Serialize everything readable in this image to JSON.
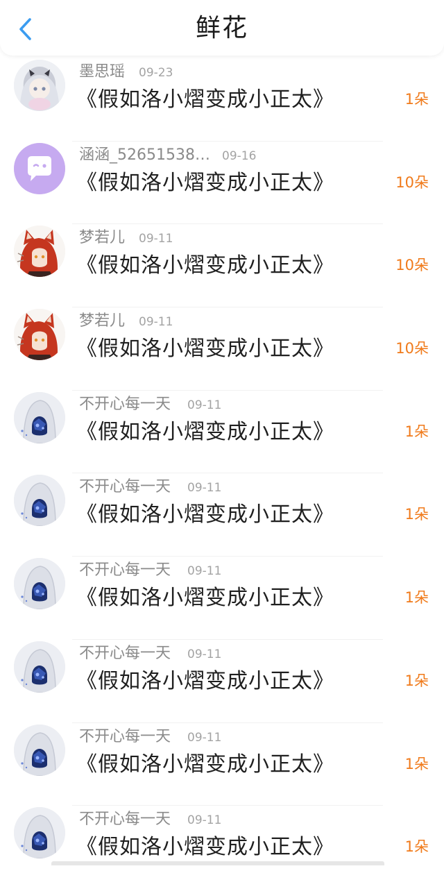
{
  "header": {
    "title": "鲜花",
    "back_icon": "chevron-left-icon",
    "accent_color": "#3b9cf0"
  },
  "colors": {
    "count": "#f07a1a",
    "name": "#8a8a8a",
    "date": "#a3a3a3",
    "title": "#1f1f1f"
  },
  "records": [
    {
      "avatar": "anime-girl-avatar",
      "user": "墨思瑶",
      "date": "09-23",
      "book": "《假如洛小熠变成小正太》",
      "count": "1朵"
    },
    {
      "avatar": "default-chat-avatar",
      "user": "涵涵_52651538…",
      "date": "09-16",
      "book": "《假如洛小熠变成小正太》",
      "count": "10朵"
    },
    {
      "avatar": "red-hair-avatar",
      "user": "梦若儿",
      "date": "09-11",
      "book": "《假如洛小熠变成小正太》",
      "count": "10朵"
    },
    {
      "avatar": "red-hair-avatar",
      "user": "梦若儿",
      "date": "09-11",
      "book": "《假如洛小熠变成小正太》",
      "count": "10朵"
    },
    {
      "avatar": "hooded-figure-avatar",
      "user": "不开心每一天",
      "date": "09-11",
      "book": "《假如洛小熠变成小正太》",
      "count": "1朵"
    },
    {
      "avatar": "hooded-figure-avatar",
      "user": "不开心每一天",
      "date": "09-11",
      "book": "《假如洛小熠变成小正太》",
      "count": "1朵"
    },
    {
      "avatar": "hooded-figure-avatar",
      "user": "不开心每一天",
      "date": "09-11",
      "book": "《假如洛小熠变成小正太》",
      "count": "1朵"
    },
    {
      "avatar": "hooded-figure-avatar",
      "user": "不开心每一天",
      "date": "09-11",
      "book": "《假如洛小熠变成小正太》",
      "count": "1朵"
    },
    {
      "avatar": "hooded-figure-avatar",
      "user": "不开心每一天",
      "date": "09-11",
      "book": "《假如洛小熠变成小正太》",
      "count": "1朵"
    },
    {
      "avatar": "hooded-figure-avatar",
      "user": "不开心每一天",
      "date": "09-11",
      "book": "《假如洛小熠变成小正太》",
      "count": "1朵"
    }
  ]
}
